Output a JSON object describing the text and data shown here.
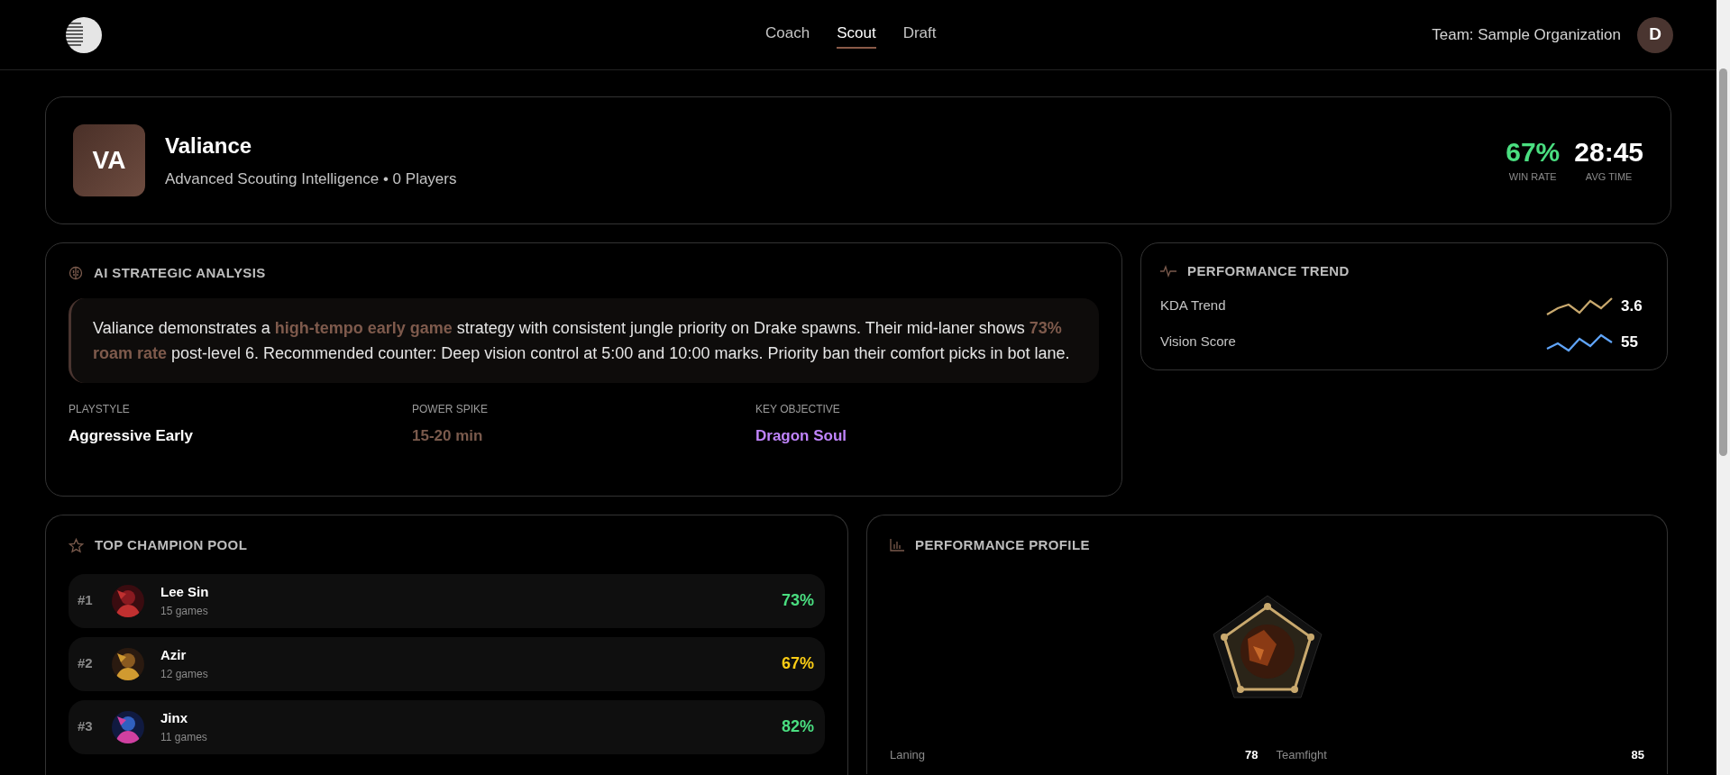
{
  "nav": {
    "tabs": [
      {
        "label": "Coach",
        "selected": false
      },
      {
        "label": "Scout",
        "selected": true
      },
      {
        "label": "Draft",
        "selected": false
      }
    ],
    "team": "Team: Sample Organization",
    "avatar": "D"
  },
  "team_header": {
    "initials": "VA",
    "name": "Valiance",
    "subtitle": "Advanced Scouting Intelligence • 0 Players",
    "stats": [
      {
        "value": "67%",
        "label": "WIN RATE",
        "color": "#4ade80"
      },
      {
        "value": "28:45",
        "label": "AVG TIME",
        "color": "#ffffff"
      }
    ]
  },
  "analysis": {
    "title": "AI STRATEGIC ANALYSIS",
    "text": "Valiance demonstrates a **high-tempo early game** strategy with consistent jungle priority on Drake spawns. Their mid-laner shows **73% roam rate** post-level 6. Recommended counter: Deep vision control at 5:00 and 10:00 marks. Priority ban their comfort picks in bot lane.",
    "facts": [
      {
        "label": "PLAYSTYLE",
        "value": "Aggressive Early",
        "color": "#ffffff"
      },
      {
        "label": "POWER SPIKE",
        "value": "15-20 min",
        "color": "#7a5a4c"
      },
      {
        "label": "KEY OBJECTIVE",
        "value": "Dragon Soul",
        "color": "#c084fc"
      }
    ]
  },
  "trend": {
    "title": "PERFORMANCE TREND",
    "rows": [
      {
        "label": "KDA Trend",
        "value": "3.6",
        "color": "#c9a96e"
      },
      {
        "label": "Vision Score",
        "value": "55",
        "color": "#60a5fa"
      }
    ]
  },
  "champions": {
    "title": "TOP CHAMPION POOL",
    "rows": [
      {
        "rank": "#1",
        "name": "Lee Sin",
        "games": "15 games",
        "rate": "73%",
        "color": "#4ade80"
      },
      {
        "rank": "#2",
        "name": "Azir",
        "games": "12 games",
        "rate": "67%",
        "color": "#facc15"
      },
      {
        "rank": "#3",
        "name": "Jinx",
        "games": "11 games",
        "rate": "82%",
        "color": "#4ade80"
      }
    ]
  },
  "profile": {
    "title": "PERFORMANCE PROFILE",
    "stats": [
      {
        "label": "Laning",
        "value": "78"
      },
      {
        "label": "Teamfight",
        "value": "85"
      }
    ]
  }
}
